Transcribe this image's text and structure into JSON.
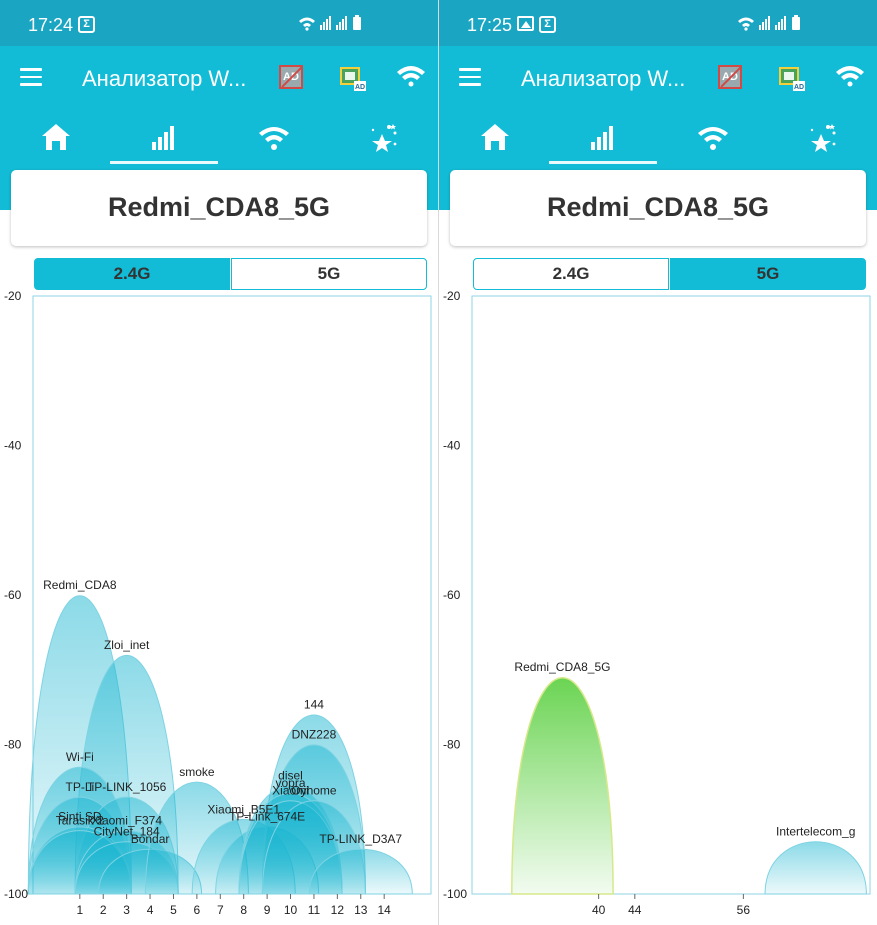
{
  "colors": {
    "status_bar": "#1aa6c2",
    "app_bar": "#13bcd6",
    "accent": "#13bcd6",
    "network_fill_cyan": "#18b5d0",
    "network_fill_green": "#7fd96a"
  },
  "screens": [
    {
      "status": {
        "time": "17:24",
        "left_icons": [
          "sigma-icon"
        ]
      },
      "app_title": "Анализатор W...",
      "nav_tabs": [
        "home-icon",
        "signal-bars-icon",
        "wifi-icon",
        "stars-icon"
      ],
      "active_tab": 1,
      "ssid": "Redmi_CDA8_5G",
      "bands": {
        "b24": "2.4G",
        "b5": "5G",
        "active": "2.4G"
      },
      "chart_data": {
        "type": "area",
        "ylim": [
          -100,
          -20
        ],
        "yticks": [
          "-20",
          "-40",
          "-60",
          "-80",
          "-100"
        ],
        "xticks": [
          "1",
          "2",
          "3",
          "4",
          "5",
          "6",
          "7",
          "8",
          "9",
          "10",
          "11",
          "12",
          "13",
          "14"
        ],
        "xlim": [
          -1,
          16
        ],
        "networks": [
          {
            "name": "Redmi_CDA8",
            "channel": 1,
            "level": -60
          },
          {
            "name": "Zloi_inet",
            "channel": 3,
            "level": -68
          },
          {
            "name": "Wi-Fi",
            "channel": 1,
            "level": -83
          },
          {
            "name": "TP-Li",
            "channel": 1,
            "level": -87
          },
          {
            "name": "TP-LINK_1056",
            "channel": 3,
            "level": -87
          },
          {
            "name": "Sinti SD",
            "channel": 1,
            "level": -91
          },
          {
            "name": "Tarasik 2",
            "channel": 1,
            "level": -91.5
          },
          {
            "name": "Xiaomi_F374",
            "channel": 3,
            "level": -91.5
          },
          {
            "name": "CityNet_184",
            "channel": 3,
            "level": -93
          },
          {
            "name": "Bondar",
            "channel": 4,
            "level": -94
          },
          {
            "name": "smoke",
            "channel": 6,
            "level": -85
          },
          {
            "name": "Xiaomi_B5E1",
            "channel": 8,
            "level": -90
          },
          {
            "name": "TP-Link_674E",
            "channel": 9,
            "level": -91
          },
          {
            "name": "144",
            "channel": 11,
            "level": -76
          },
          {
            "name": "DNZ228",
            "channel": 11,
            "level": -80
          },
          {
            "name": "disel",
            "channel": 10,
            "level": -85.5
          },
          {
            "name": "vopra",
            "channel": 10,
            "level": -86.5
          },
          {
            "name": "Xiaomi",
            "channel": 10,
            "level": -87.5
          },
          {
            "name": "Oyhome",
            "channel": 11,
            "level": -87.5
          },
          {
            "name": "TP-LINK_D3A7",
            "channel": 13,
            "level": -94
          }
        ]
      }
    },
    {
      "status": {
        "time": "17:25",
        "left_icons": [
          "image-icon",
          "sigma-icon"
        ]
      },
      "app_title": "Анализатор W...",
      "nav_tabs": [
        "home-icon",
        "signal-bars-icon",
        "wifi-icon",
        "stars-icon"
      ],
      "active_tab": 1,
      "ssid": "Redmi_CDA8_5G",
      "bands": {
        "b24": "2.4G",
        "b5": "5G",
        "active": "5G"
      },
      "chart_data": {
        "type": "area",
        "ylim": [
          -100,
          -20
        ],
        "yticks": [
          "-20",
          "-40",
          "-60",
          "-80",
          "-100"
        ],
        "xticks": [
          "40",
          "44",
          "56"
        ],
        "xlim": [
          26,
          70
        ],
        "networks": [
          {
            "name": "Redmi_CDA8_5G",
            "channel": 36,
            "level": -71,
            "color": "green"
          },
          {
            "name": "Intertelecom_g",
            "channel": 64,
            "level": -93,
            "color": "cyan"
          }
        ]
      }
    }
  ]
}
